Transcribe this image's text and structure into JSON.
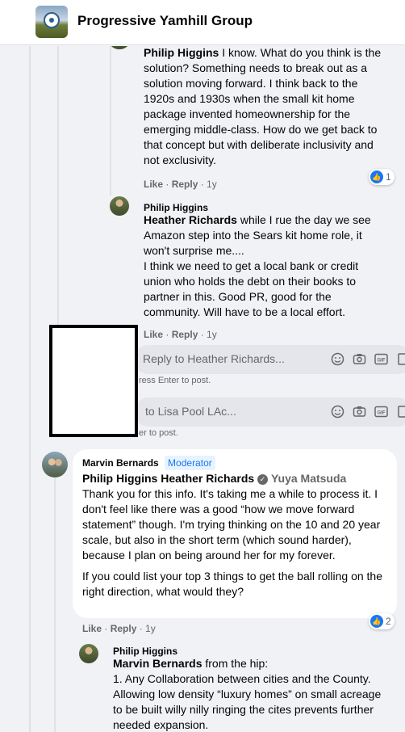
{
  "header": {
    "group_name": "Progressive Yamhill Group"
  },
  "comments": [
    {
      "author": "Philip Higgins",
      "text": "I know. What do you think is the solution? Something needs to break out as a solution moving forward. I think back to the 1920s and 1930s when the small kit home package invented homeownership for the emerging middle-class. How do we get back to that concept but with deliberate inclusivity and not exclusivity.",
      "like": "Like",
      "reply": "Reply",
      "time": "1y",
      "reactions": "1"
    },
    {
      "author": "Philip Higgins",
      "mention": "Heather Richards",
      "text": "while I rue the day we see Amazon step into the Sears kit home role, it won't surprise me....",
      "text2": "I think we need to get a local bank or credit union who holds the debt on their books to partner in this. Good PR, good for the community. Will have to be a local effort.",
      "like": "Like",
      "reply": "Reply",
      "time": "1y"
    },
    {
      "author": "Marvin Bernards",
      "badge": "Moderator",
      "mention1": "Philip Higgins",
      "mention2": "Heather Richards",
      "mention3": "Yuya Matsuda",
      "text": "Thank you for this info. It's taking me a while to process it. I don't feel like there was a good “how we move forward statement” though. I'm trying thinking on the 10 and 20 year scale, but also in the short term (which sound harder), because I plan on being around her for my forever.",
      "text2": "If you could list your top 3 things to get the ball rolling on the right direction, what would they?",
      "like": "Like",
      "reply": "Reply",
      "time": "1y",
      "reactions": "2"
    },
    {
      "author": "Philip Higgins",
      "mention": "Marvin Bernards",
      "text": "from the hip:",
      "text2": "1. Any Collaboration between cities and the County. Allowing low density “luxury homes” on small acreage to be built willy nilly ringing the cites prevents further needed expansion."
    }
  ],
  "reply_boxes": [
    {
      "placeholder": "Reply to Heather Richards...",
      "hint": "ress Enter to post."
    },
    {
      "placeholder": "to Lisa Pool LAc...",
      "hint": "er to post."
    }
  ],
  "icons": [
    "emoji-icon",
    "camera-icon",
    "gif-icon",
    "sticker-icon"
  ],
  "colors": {
    "accent": "#1877f2",
    "bubble": "#f0f2f5",
    "background": "#f0f2f5"
  }
}
